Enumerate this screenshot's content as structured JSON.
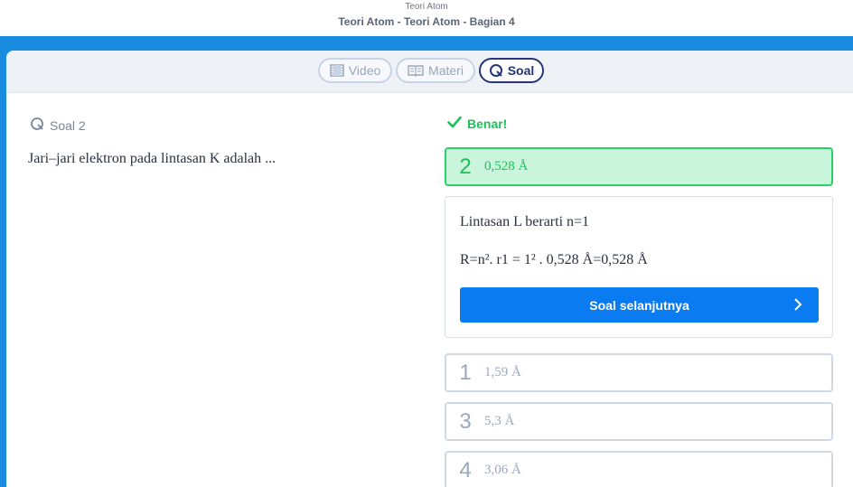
{
  "header": {
    "subtitle": "Teori Atom",
    "title": "Teori Atom - Teori Atom - Bagian 4"
  },
  "tabs": [
    {
      "label": "Video",
      "icon": "film-icon"
    },
    {
      "label": "Materi",
      "icon": "book-icon"
    },
    {
      "label": "Soal",
      "icon": "quiz-icon",
      "active": true
    }
  ],
  "question": {
    "label": "Soal 2",
    "text": "Jari–jari elektron pada lintasan K adalah ..."
  },
  "result": {
    "status": "Benar!"
  },
  "options": [
    {
      "number": "2",
      "text": "0,528 Å",
      "state": "correct"
    },
    {
      "number": "1",
      "text": "1,59 Å"
    },
    {
      "number": "3",
      "text": "5,3 Å"
    },
    {
      "number": "4",
      "text": "3,06 Å"
    }
  ],
  "explanation": {
    "line1": "Lintasan L berarti n=1",
    "line2": "R=n². r1 = 1² . 0,528 Å=0,528 Å",
    "next_button": "Soal selanjutnya"
  },
  "colors": {
    "brand_blue": "#1a8ce0",
    "button_blue": "#0a7bf0",
    "correct_green": "#1fbf5c",
    "active_tab": "#27357a"
  }
}
